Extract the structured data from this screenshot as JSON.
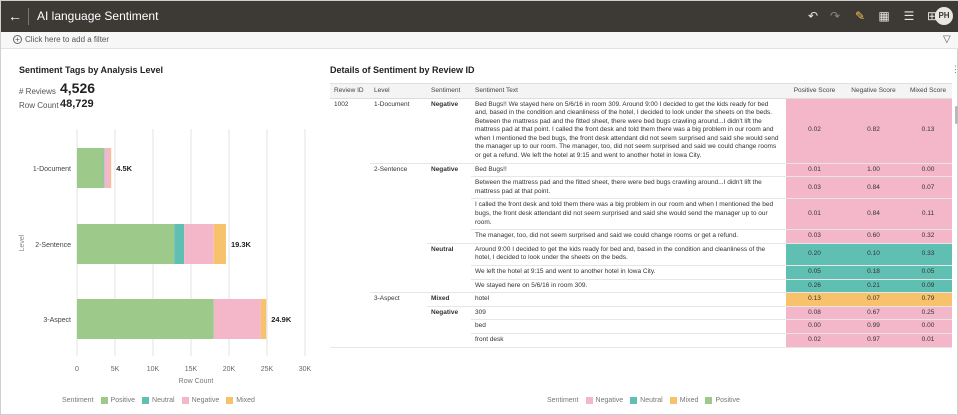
{
  "app": {
    "title": "AI language Sentiment",
    "user_initials": "PH"
  },
  "toolbar": {
    "icons": [
      "undo-icon",
      "redo-icon",
      "edit-icon",
      "present-icon",
      "notes-icon",
      "export-icon"
    ]
  },
  "filter": {
    "placeholder": "Click here to add a filter"
  },
  "left": {
    "title": "Sentiment Tags by Analysis Level",
    "reviews_label": "# Reviews",
    "reviews_value": "4,526",
    "rowcount_label": "Row Count",
    "rowcount_value": "48,729",
    "legend_title": "Sentiment",
    "legend": [
      {
        "name": "Positive",
        "color": "#9dc98a"
      },
      {
        "name": "Neutral",
        "color": "#5fbfb3"
      },
      {
        "name": "Negative",
        "color": "#f3b7c9"
      },
      {
        "name": "Mixed",
        "color": "#f7c26b"
      }
    ]
  },
  "chart_data": {
    "type": "bar",
    "orientation": "horizontal",
    "stacked": true,
    "categories": [
      "1-Document",
      "2-Sentence",
      "3-Aspect"
    ],
    "series": [
      {
        "name": "Positive",
        "values": [
          3.5,
          12.8,
          18.0
        ]
      },
      {
        "name": "Neutral",
        "values": [
          0.1,
          1.3,
          0.0
        ]
      },
      {
        "name": "Negative",
        "values": [
          0.8,
          3.9,
          6.2
        ]
      },
      {
        "name": "Mixed",
        "values": [
          0.1,
          1.6,
          0.7
        ]
      }
    ],
    "totals_labels": [
      "4.5K",
      "19.3K",
      "24.9K"
    ],
    "xlabel": "Row Count",
    "ylabel": "Level",
    "xticks": [
      "0",
      "5K",
      "10K",
      "15K",
      "20K",
      "25K",
      "30K"
    ],
    "xlim": [
      0,
      30
    ],
    "grid": true,
    "legend_position": "bottom"
  },
  "right": {
    "title": "Details of Sentiment by Review ID",
    "headers": [
      "Review ID",
      "Level",
      "Sentiment",
      "Sentiment Text",
      "Positive Score",
      "Negative Score",
      "Mixed Score"
    ],
    "legend_title": "Sentiment",
    "legend": [
      {
        "name": "Negative",
        "color": "#f3b7c9"
      },
      {
        "name": "Neutral",
        "color": "#5fbfb3"
      },
      {
        "name": "Mixed",
        "color": "#f7c26b"
      },
      {
        "name": "Positive",
        "color": "#9dc98a"
      }
    ],
    "rows": [
      {
        "review_id": "1002",
        "level": "1-Document",
        "sentiment": "Negative",
        "text": "Bed Bugs!! We stayed here on 5/6/16 in room 309. Around 9:00 I decided to get the kids ready for bed and, based in the condition and cleanliness of the hotel, I decided to look under the sheets on the beds. Between the mattress pad and the fitted sheet, there were bed bugs crawling around...I didn't lift the mattress pad at that point. I called the front desk and told them there was a big problem in our room and when I mentioned the bed bugs, the front desk attendant did not seem surprised and said she would send the manager up to our room. The manager, too, did not seem surprised and said we could change rooms or get a refund. We left the hotel at 9:15 and went to another hotel in Iowa City.",
        "pos": "0.02",
        "neg": "0.82",
        "mix": "0.13",
        "color": "#f3b7c9"
      },
      {
        "review_id": "",
        "level": "2-Sentence",
        "sentiment": "Negative",
        "text": "Bed Bugs!!",
        "pos": "0.01",
        "neg": "1.00",
        "mix": "0.00",
        "color": "#f3b7c9"
      },
      {
        "review_id": "",
        "level": "",
        "sentiment": "",
        "text": "Between the mattress pad and the fitted sheet, there were bed bugs crawling around...I didn't lift the mattress pad at that point.",
        "pos": "0.03",
        "neg": "0.84",
        "mix": "0.07",
        "color": "#f3b7c9"
      },
      {
        "review_id": "",
        "level": "",
        "sentiment": "",
        "text": "I called the front desk and told them there was a big problem in our room and when I mentioned the bed bugs, the front desk attendant did not seem surprised and said she would send the manager up to our room.",
        "pos": "0.01",
        "neg": "0.84",
        "mix": "0.11",
        "color": "#f3b7c9"
      },
      {
        "review_id": "",
        "level": "",
        "sentiment": "",
        "text": "The manager, too, did not seem surprised and said we could change rooms or get a refund.",
        "pos": "0.03",
        "neg": "0.60",
        "mix": "0.32",
        "color": "#f3b7c9"
      },
      {
        "review_id": "",
        "level": "",
        "sentiment": "Neutral",
        "text": "Around 9:00 I decided to get the kids ready for bed and, based in the condition and cleanliness of the hotel, I decided to look under the sheets on the beds.",
        "pos": "0.20",
        "neg": "0.10",
        "mix": "0.33",
        "color": "#5fbfb3"
      },
      {
        "review_id": "",
        "level": "",
        "sentiment": "",
        "text": "We left the hotel at 9:15 and went to another hotel in Iowa City.",
        "pos": "0.05",
        "neg": "0.18",
        "mix": "0.05",
        "color": "#5fbfb3"
      },
      {
        "review_id": "",
        "level": "",
        "sentiment": "",
        "text": "We stayed here on 5/6/16 in room 309.",
        "pos": "0.26",
        "neg": "0.21",
        "mix": "0.09",
        "color": "#5fbfb3"
      },
      {
        "review_id": "",
        "level": "3-Aspect",
        "sentiment": "Mixed",
        "text": "hotel",
        "pos": "0.13",
        "neg": "0.07",
        "mix": "0.79",
        "color": "#f7c26b"
      },
      {
        "review_id": "",
        "level": "",
        "sentiment": "Negative",
        "text": "309",
        "pos": "0.08",
        "neg": "0.67",
        "mix": "0.25",
        "color": "#f3b7c9"
      },
      {
        "review_id": "",
        "level": "",
        "sentiment": "",
        "text": "bed",
        "pos": "0.00",
        "neg": "0.99",
        "mix": "0.00",
        "color": "#f3b7c9"
      },
      {
        "review_id": "",
        "level": "",
        "sentiment": "",
        "text": "front desk",
        "pos": "0.02",
        "neg": "0.97",
        "mix": "0.01",
        "color": "#f3b7c9"
      }
    ]
  }
}
